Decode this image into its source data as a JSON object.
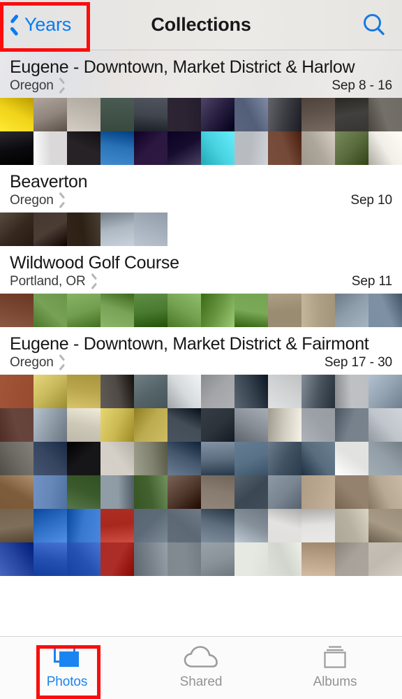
{
  "navbar": {
    "back_label": "Years",
    "back_icon": "chevron-left-icon",
    "title": "Collections",
    "search_icon": "search-icon"
  },
  "sections": [
    {
      "title": "Eugene - Downtown, Market District & Harlow",
      "place": "Oregon",
      "date": "Sep 8 - 16",
      "disclosure_icon": "chevron-right-icon",
      "frosted": true,
      "photo_count": 24,
      "grid_rows": 2,
      "thumbs": [
        "#f2d41c",
        "#8d8279",
        "#cdc6bc",
        "#4a5b52",
        "#3a3f47",
        "#2a2230",
        "#3a3152",
        "#5f6a84",
        "#4b4b52",
        "#6c5f57",
        "#3b3936",
        "#6e6a63",
        "#1d1d21",
        "#eceaea",
        "#241f22",
        "#2c74b8",
        "#2b1740",
        "#271d3e",
        "#3ec8d6",
        "#c9cdd2",
        "#7a4f3e",
        "#b9b2a6",
        "#6b7d4e",
        "#e8e6df"
      ]
    },
    {
      "title": "Beaverton",
      "place": "Oregon",
      "date": "Sep 10",
      "disclosure_icon": "chevron-right-icon",
      "frosted": false,
      "photo_count": 5,
      "grid_rows": 1,
      "thumbs": [
        "#36291e",
        "#41332a",
        "#3a2d22",
        "#a9b3bd",
        "#9ba6b2"
      ]
    },
    {
      "title": "Wildwood Golf Course",
      "place": "Portland, OR",
      "date": "Sep 11",
      "disclosure_icon": "chevron-right-icon",
      "frosted": false,
      "photo_count": 12,
      "grid_rows": 1,
      "thumbs": [
        "#8d5a46",
        "#6f9a4e",
        "#74a051",
        "#6f9a4e",
        "#5f8f45",
        "#6d9b4a",
        "#76a44f",
        "#6f9f4c",
        "#b0a287",
        "#b5a78c",
        "#9aa9b6",
        "#7f92a6"
      ]
    },
    {
      "title": "Eugene - Downtown, Market District & Fairmont",
      "place": "Oregon",
      "date": "Sep 17 - 30",
      "disclosure_icon": "chevron-right-icon",
      "frosted": false,
      "photo_count": 72,
      "grid_rows": 6,
      "thumbs": [
        "#a3563a",
        "#c1b255",
        "#bba84e",
        "#4e4844",
        "#5f6e72",
        "#cfd2d4",
        "#a6a8ab",
        "#3f4b57",
        "#d4d6d8",
        "#5a6570",
        "#b7b9bc",
        "#8a9aa8",
        "#5d3b33",
        "#9eaab5",
        "#cbc6b6",
        "#c7b64f",
        "#c9b85b",
        "#3b454f",
        "#2c333b",
        "#8e949b",
        "#d9d4c8",
        "#b0b5bb",
        "#6b7580",
        "#b6bcc2",
        "#6d6a63",
        "#2a3a55",
        "#151517",
        "#d7d3cb",
        "#8e8f7d",
        "#4b5e74",
        "#5b6d7e",
        "#60798f",
        "#4a5b6b",
        "#5c6f80",
        "#f2f2f0",
        "#8f9aa3",
        "#8b6b4a",
        "#6d8fc0",
        "#4a6a3c",
        "#8e9aa4",
        "#4e6d3b",
        "#5a4336",
        "#7f7368",
        "#4f5b66",
        "#6f7b86",
        "#b7a48c",
        "#95826e",
        "#c3b49f",
        "#7a6a55",
        "#2f6fc6",
        "#2f6fc6",
        "#b7362c",
        "#5c6a77",
        "#6b7683",
        "#60707e",
        "#9aa5b0",
        "#e4e3e1",
        "#e6e5e3",
        "#cdc7b8",
        "#a0937f",
        "#1f3f9a",
        "#2b58b8",
        "#2b58b8",
        "#aa2a26",
        "#7c858d",
        "#7f888f",
        "#848d94",
        "#e5e8e0",
        "#e6e9e1",
        "#b59d83",
        "#b0aaa2",
        "#c9c3b9"
      ]
    }
  ],
  "tabbar": {
    "tabs": [
      {
        "label": "Photos",
        "icon": "photos-stack-icon",
        "active": true
      },
      {
        "label": "Shared",
        "icon": "cloud-icon",
        "active": false
      },
      {
        "label": "Albums",
        "icon": "albums-icon",
        "active": false
      }
    ]
  },
  "annotations": {
    "highlight_color": "#fb0d0d",
    "boxes": [
      {
        "target": "back-button",
        "label": "Years"
      },
      {
        "target": "tab-photos",
        "label": "Photos"
      }
    ]
  },
  "colors": {
    "accent_blue": "#0a7cf0",
    "tab_active": "#1a84f0",
    "tab_inactive": "#939396",
    "navbar_bg": "#e9e7e4",
    "highlight_red": "#fb0d0d"
  }
}
